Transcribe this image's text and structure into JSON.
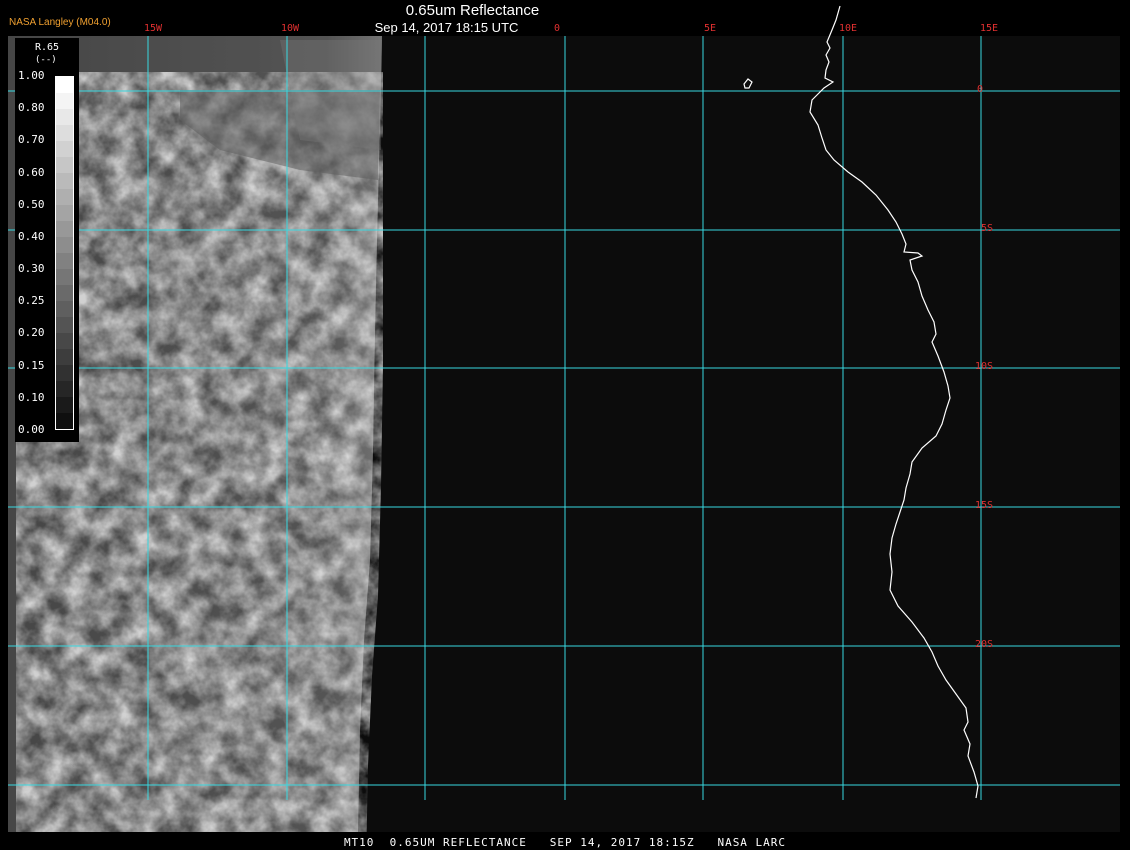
{
  "header": {
    "title": "0.65um Reflectance",
    "subtitle": "Sep 14, 2017 18:15 UTC",
    "credit": "NASA Langley (M04.0)"
  },
  "footer": {
    "text": "MT10  0.65UM REFLECTANCE   SEP 14, 2017 18:15Z   NASA LARC"
  },
  "legend": {
    "name": "R.65",
    "units": "(--)",
    "ticks": [
      "1.00",
      "0.80",
      "0.70",
      "0.60",
      "0.50",
      "0.40",
      "0.30",
      "0.25",
      "0.20",
      "0.15",
      "0.10",
      "0.00"
    ]
  },
  "grid": {
    "longitude_labels": [
      "15W",
      "10W",
      "0",
      "5E",
      "10E",
      "15E"
    ],
    "latitude_labels": [
      "0",
      "5S",
      "10S",
      "15S",
      "20S"
    ],
    "line_color": "#38d8e0",
    "label_color": "#e03030"
  },
  "colors": {
    "background": "#0c0c0c",
    "coastline": "#ffffff",
    "imagery": "#8a8a8a"
  }
}
